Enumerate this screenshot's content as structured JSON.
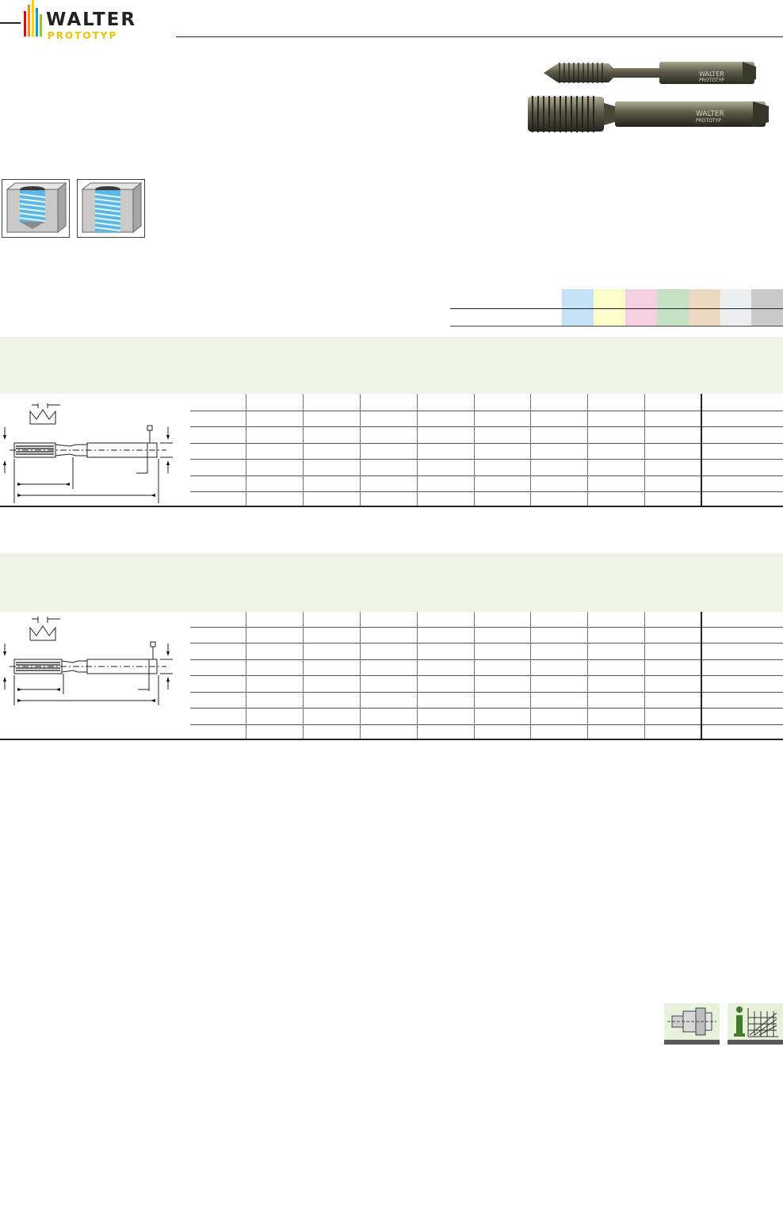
{
  "brand": {
    "name": "WALTER",
    "subline": "PROTOTYP",
    "bar_colors": [
      "#e30613",
      "#f39200",
      "#ffd500",
      "#009fe3",
      "#8cc63f"
    ]
  },
  "material_colors": [
    "#c6e3f6",
    "#fdfbc8",
    "#f6cfe3",
    "#c5e1c3",
    "#ecd9c2",
    "#eceef0",
    "#cacaca"
  ],
  "icons": {
    "machining": [
      "blind-hole-thread-icon",
      "through-hole-thread-icon"
    ],
    "footer": [
      "tool-holder-icon",
      "technical-info-icon"
    ]
  },
  "colors": {
    "section_band": "#eef5e6",
    "footer_icon_bg": "#e7f1dc",
    "thread_blue": "#5bb8e6"
  }
}
